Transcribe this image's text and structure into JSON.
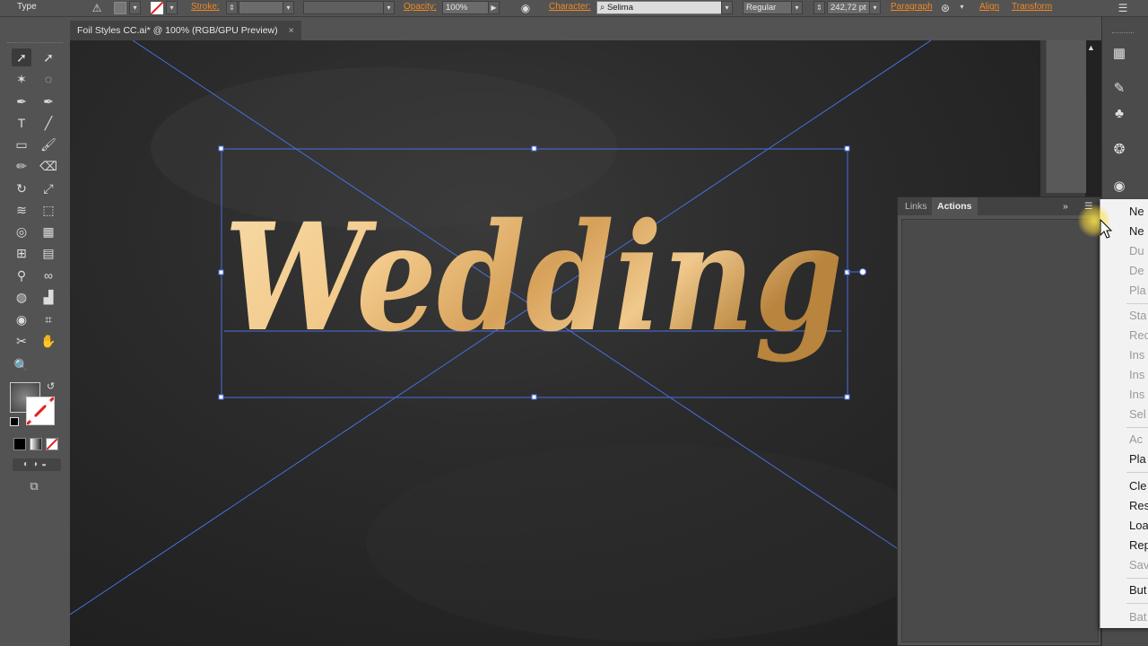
{
  "control_bar": {
    "mode_label": "Type",
    "stroke_label": "Stroke:",
    "opacity_label": "Opacity:",
    "opacity_value": "100%",
    "character_label": "Character:",
    "font_family": "Selima",
    "font_style": "Regular",
    "font_size": "242,72 pt",
    "paragraph_label": "Paragraph",
    "align_label": "Align",
    "transform_label": "Transform"
  },
  "document_tab": {
    "title": "Foil Styles CC.ai* @ 100% (RGB/GPU Preview)",
    "close": "×"
  },
  "canvas": {
    "artwork_text": "Wedding",
    "background_color": "#262626",
    "guide_color": "#4a6fe0",
    "gold_light": "#f5d9a2",
    "gold_dark": "#b8843e"
  },
  "tools": [
    {
      "name": "selection-tool",
      "glyph": "➚"
    },
    {
      "name": "direct-selection-tool",
      "glyph": "➚"
    },
    {
      "name": "magic-wand-tool",
      "glyph": "✶"
    },
    {
      "name": "lasso-tool",
      "glyph": "◌"
    },
    {
      "name": "pen-tool",
      "glyph": "✒"
    },
    {
      "name": "curvature-tool",
      "glyph": "✒"
    },
    {
      "name": "type-tool",
      "glyph": "T"
    },
    {
      "name": "line-tool",
      "glyph": "╱"
    },
    {
      "name": "rectangle-tool",
      "glyph": "▭"
    },
    {
      "name": "paintbrush-tool",
      "glyph": "🖌"
    },
    {
      "name": "pencil-tool",
      "glyph": "✏"
    },
    {
      "name": "eraser-tool",
      "glyph": "⌫"
    },
    {
      "name": "rotate-tool",
      "glyph": "↻"
    },
    {
      "name": "scale-tool",
      "glyph": "⤢"
    },
    {
      "name": "width-tool",
      "glyph": "≋"
    },
    {
      "name": "free-transform-tool",
      "glyph": "⬚"
    },
    {
      "name": "shape-builder-tool",
      "glyph": "◎"
    },
    {
      "name": "perspective-grid-tool",
      "glyph": "▦"
    },
    {
      "name": "mesh-tool",
      "glyph": "⊞"
    },
    {
      "name": "gradient-tool",
      "glyph": "▤"
    },
    {
      "name": "eyedropper-tool",
      "glyph": "⚲"
    },
    {
      "name": "blend-tool",
      "glyph": "∞"
    },
    {
      "name": "symbol-sprayer-tool",
      "glyph": "◍"
    },
    {
      "name": "column-graph-tool",
      "glyph": "▟"
    },
    {
      "name": "symbol-tool",
      "glyph": "◉"
    },
    {
      "name": "artboard-tool",
      "glyph": "⌗"
    },
    {
      "name": "slice-tool",
      "glyph": "✂"
    },
    {
      "name": "hand-tool",
      "glyph": "✋"
    },
    {
      "name": "zoom-tool",
      "glyph": "🔍"
    }
  ],
  "panels": {
    "tab_links": "Links",
    "tab_actions": "Actions",
    "collapse_glyph": "»",
    "menu_glyph": "☰"
  },
  "flyout_menu": [
    {
      "label": "Ne",
      "enabled": true
    },
    {
      "label": "Ne",
      "enabled": true
    },
    {
      "label": "Du",
      "enabled": false
    },
    {
      "label": "De",
      "enabled": false
    },
    {
      "label": "Pla",
      "enabled": false
    },
    {
      "label": "Sta",
      "enabled": false
    },
    {
      "label": "Rec",
      "enabled": false
    },
    {
      "label": "Ins",
      "enabled": false
    },
    {
      "label": "Ins",
      "enabled": false
    },
    {
      "label": "Ins",
      "enabled": false
    },
    {
      "label": "Sel",
      "enabled": false
    },
    {
      "label": "Ac",
      "enabled": false
    },
    {
      "label": "Pla",
      "enabled": true
    },
    {
      "label": "Cle",
      "enabled": true
    },
    {
      "label": "Res",
      "enabled": true
    },
    {
      "label": "Loa",
      "enabled": true
    },
    {
      "label": "Rep",
      "enabled": true
    },
    {
      "label": "Sav",
      "enabled": false
    },
    {
      "label": "But",
      "enabled": true
    },
    {
      "label": "Bat",
      "enabled": false
    }
  ]
}
